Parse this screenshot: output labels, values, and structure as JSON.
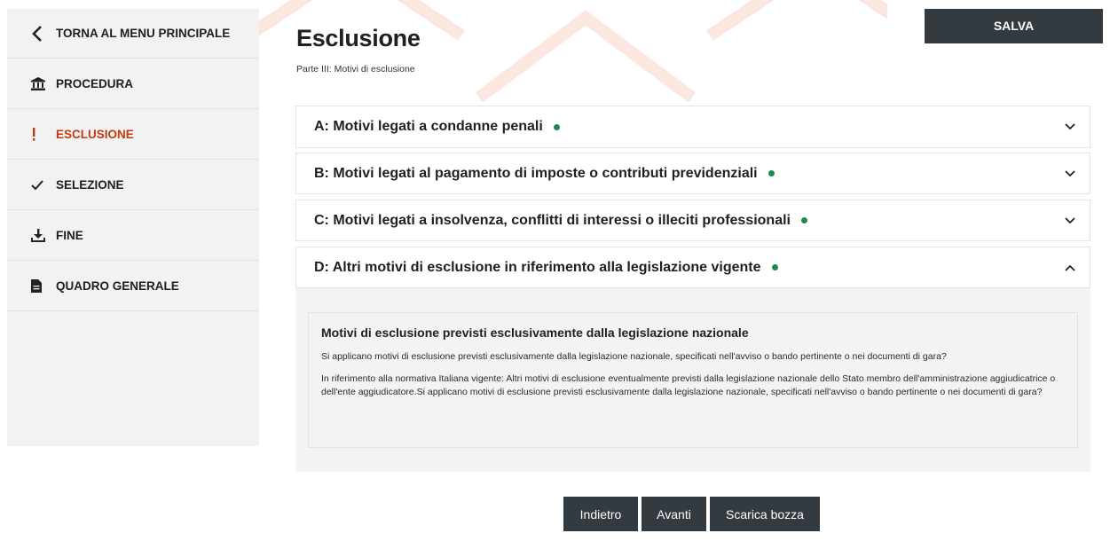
{
  "sidebar": {
    "items": [
      {
        "label": "TORNA AL MENU PRINCIPALE",
        "icon": "chevron-left-icon"
      },
      {
        "label": "PROCEDURA",
        "icon": "bank-icon"
      },
      {
        "label": "ESCLUSIONE",
        "icon": "exclamation-icon",
        "active": true
      },
      {
        "label": "SELEZIONE",
        "icon": "check-icon"
      },
      {
        "label": "FINE",
        "icon": "download-icon"
      },
      {
        "label": "QUADRO GENERALE",
        "icon": "document-icon"
      }
    ]
  },
  "header": {
    "title": "Esclusione",
    "subtitle": "Parte III: Motivi di esclusione",
    "save_label": "SALVA"
  },
  "sections": [
    {
      "label": "A: Motivi legati a condanne penali",
      "expanded": false
    },
    {
      "label": "B: Motivi legati al pagamento di imposte o contributi previdenziali",
      "expanded": false
    },
    {
      "label": "C: Motivi legati a insolvenza, conflitti di interessi o illeciti professionali",
      "expanded": false
    },
    {
      "label": "D: Altri motivi di esclusione in riferimento alla legislazione vigente",
      "expanded": true
    }
  ],
  "panel": {
    "heading": "Motivi di esclusione previsti esclusivamente dalla legislazione nazionale",
    "question": "Si applicano motivi di esclusione previsti esclusivamente dalla legislazione nazionale, specificati nell'avviso o bando pertinente o nei documenti di gara?",
    "description": "In riferimento alla normativa Italiana vigente: Altri motivi di esclusione eventualmente previsti dalla legislazione nazionale dello Stato membro dell'amministrazione aggiudicatrice o dell'ente aggiudicatore.Si applicano motivi di esclusione previsti esclusivamente dalla legislazione nazionale, specificati nell'avviso o bando pertinente o nei documenti di gara?"
  },
  "footer": {
    "back_label": "Indietro",
    "next_label": "Avanti",
    "draft_label": "Scarica bozza"
  },
  "colors": {
    "accent": "#c13b12",
    "status_ok": "#1d8a4d",
    "button_dark": "#333a40",
    "sidebar_bg": "#f2f2f2"
  }
}
